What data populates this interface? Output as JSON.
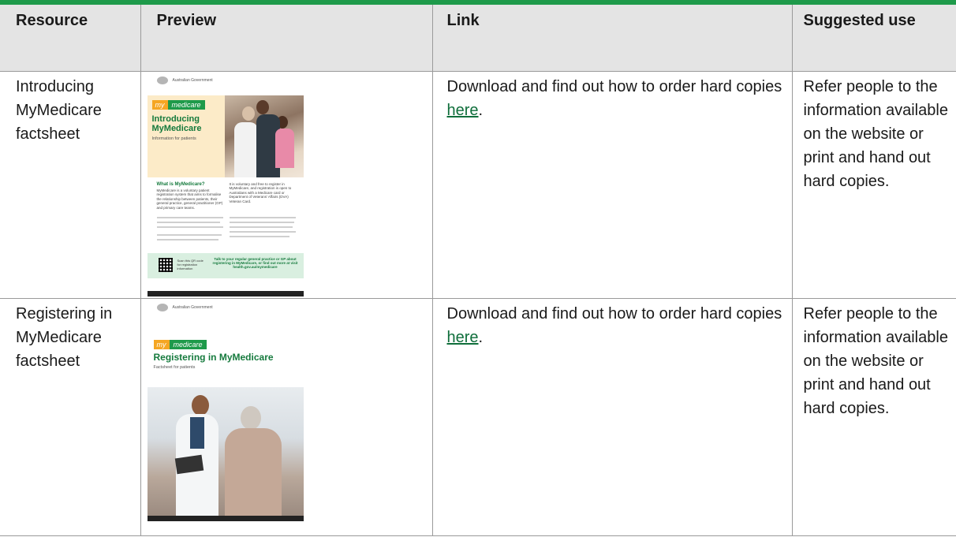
{
  "table": {
    "headers": {
      "resource": "Resource",
      "preview": "Preview",
      "link": "Link",
      "suggested_use": "Suggested use"
    },
    "rows": [
      {
        "resource": "Introducing MyMedicare factsheet",
        "link_text": "Download and find out how to order hard copies ",
        "link_anchor": "here",
        "link_suffix": ".",
        "suggested_use": "Refer people to the information available on the website or print and hand out hard copies.",
        "preview": {
          "gov_label": "Australian Government",
          "badge_my": "my",
          "badge_medicare": "medicare",
          "doc_title_1": "Introducing",
          "doc_title_2": "MyMedicare",
          "doc_subtitle": "Information for patients",
          "section_heading": "What is MyMedicare?",
          "col1_text": "MyMedicare is a voluntary patient registration system that aims to formalise the relationship between patients, their general practice, general practitioner (GP) and primary care teams.",
          "col2_text": "It is voluntary and free to register in MyMedicare, and registration is open to Australians with a Medicare card or Department of Veterans' Affairs (DVA) Veteran Card.",
          "footer_scan": "Scan this QR code for registration information",
          "footer_cta": "Talk to your regular general practice or GP about registering in MyMedicare, or find out more at visit health.gov.au/mymedicare"
        }
      },
      {
        "resource": "Registering in MyMedicare factsheet",
        "link_text": "Download and find out how to order hard copies ",
        "link_anchor": "here",
        "link_suffix": ".",
        "suggested_use": "Refer people to the information available on the website or print and hand out hard copies.",
        "preview": {
          "gov_label": "Australian Government",
          "badge_my": "my",
          "badge_medicare": "medicare",
          "doc_title": "Registering in MyMedicare",
          "doc_subtitle": "Factsheet for patients"
        }
      }
    ]
  },
  "colors": {
    "accent_green": "#1e9a4a",
    "link_green": "#0f6e3b",
    "header_bg": "#e4e4e4"
  }
}
